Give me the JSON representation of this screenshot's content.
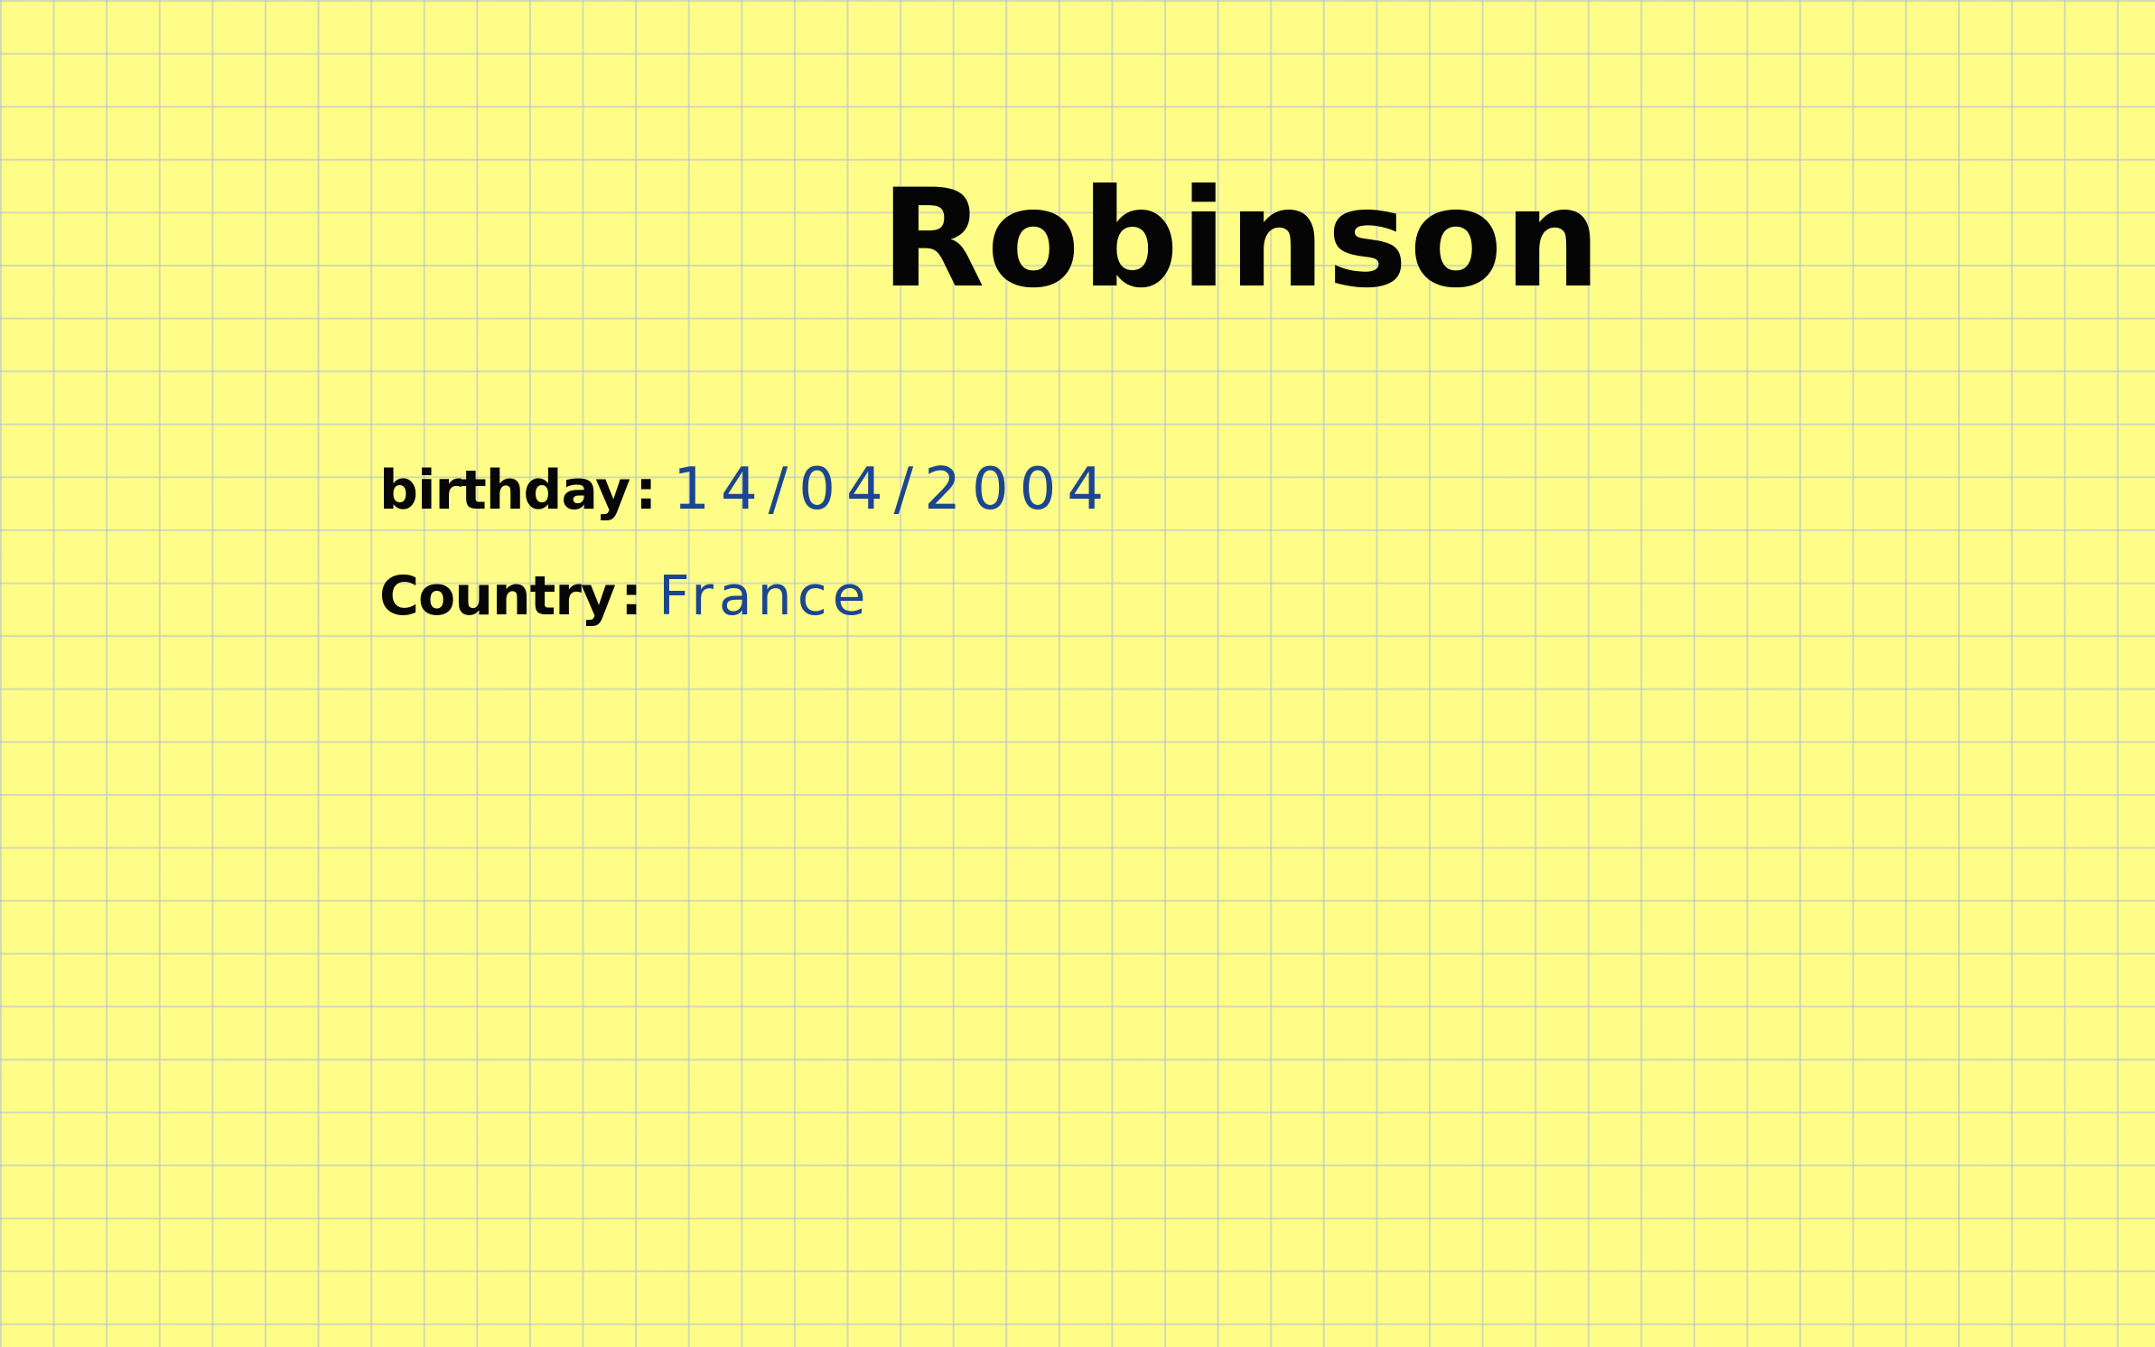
{
  "note": {
    "title": "Robinson",
    "fields": [
      {
        "label": "birthday",
        "separator": ":",
        "value": "14/04/2004"
      },
      {
        "label": "Country",
        "separator": ":",
        "value": "France"
      }
    ]
  },
  "colors": {
    "paper": "#fefd87",
    "grid": "#afbed7",
    "ink_black": "#070707",
    "ink_blue": "#1b4590"
  }
}
